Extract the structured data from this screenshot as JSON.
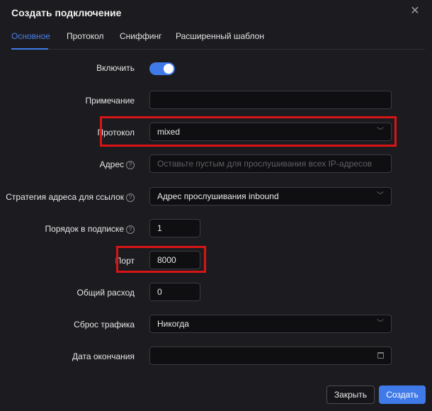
{
  "dialog": {
    "title": "Создать подключение",
    "close_glyph": "✕"
  },
  "tabs": [
    {
      "label": "Основное",
      "active": true
    },
    {
      "label": "Протокол",
      "active": false
    },
    {
      "label": "Сниффинг",
      "active": false
    },
    {
      "label": "Расширенный шаблон",
      "active": false
    }
  ],
  "form": {
    "enable": {
      "label": "Включить",
      "value": true
    },
    "remark": {
      "label": "Примечание",
      "value": ""
    },
    "protocol": {
      "label": "Протокол",
      "value": "mixed"
    },
    "address": {
      "label": "Адрес",
      "placeholder": "Оставьте пустым для прослушивания всех IP-адресов"
    },
    "link_strategy": {
      "label": "Стратегия адреса для ссылок",
      "value": "Адрес прослушивания inbound"
    },
    "sub_order": {
      "label": "Порядок в подписке",
      "value": "1"
    },
    "port": {
      "label": "Порт",
      "value": "8000"
    },
    "total_traffic": {
      "label": "Общий расход",
      "value": "0"
    },
    "traffic_reset": {
      "label": "Сброс трафика",
      "value": "Никогда"
    },
    "expiry": {
      "label": "Дата окончания",
      "value": ""
    }
  },
  "help_glyph": "?",
  "chevron_glyph": "﹀",
  "buttons": {
    "close": "Закрыть",
    "create": "Создать"
  },
  "colors": {
    "accent": "#3f7ae8",
    "highlight": "#d81414",
    "background": "#1c1c20"
  }
}
